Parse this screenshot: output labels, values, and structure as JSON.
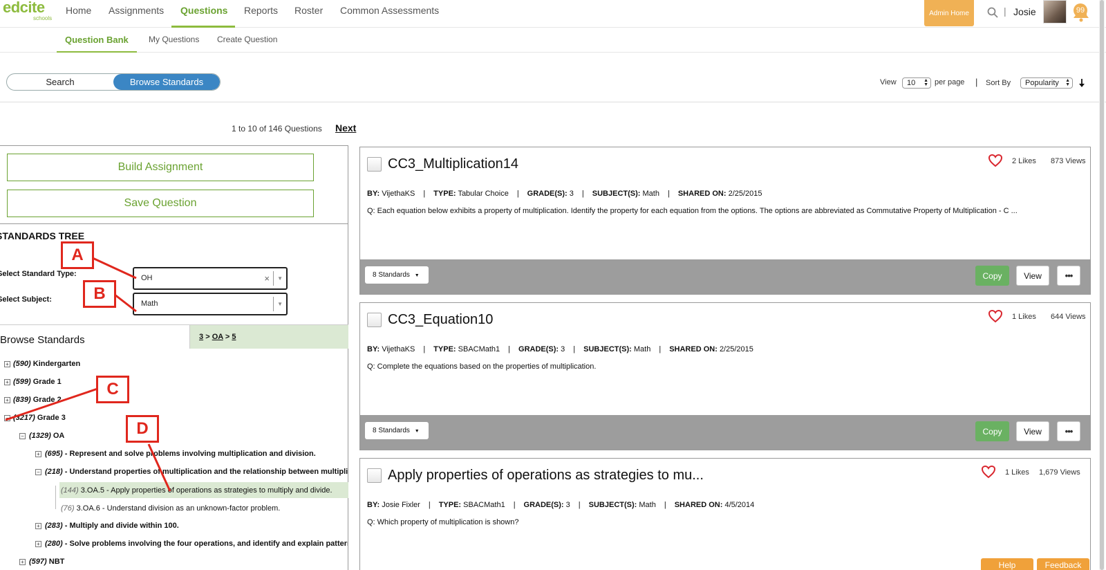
{
  "logo": {
    "text": "edcite",
    "sub": "schools"
  },
  "topnav": {
    "items": [
      "Home",
      "Assignments",
      "Questions",
      "Reports",
      "Roster",
      "Common Assessments"
    ],
    "admin_home": "Admin Home",
    "separator": "|",
    "user": "Josie",
    "notifications": "99"
  },
  "subnav": {
    "items": [
      "Question Bank",
      "My Questions",
      "Create Question"
    ]
  },
  "toggle": {
    "search": "Search",
    "browse": "Browse Standards"
  },
  "list_controls": {
    "view_label": "View",
    "per_page_value": "10",
    "per_page_label": "per page",
    "separator": "|",
    "sort_label": "Sort By",
    "sort_value": "Popularity"
  },
  "pager": {
    "text": "1 to 10 of 146 Questions",
    "next": "Next"
  },
  "left_panel": {
    "build_assignment": "Build Assignment",
    "save_question": "Save Question",
    "tree_title": "STANDARDS TREE",
    "standard_type_label": "Select Standard Type:",
    "standard_type_value": "OH",
    "subject_label": "Select Subject:",
    "subject_value": "Math",
    "browse_title": "Browse Standards",
    "crumb": [
      "3",
      "OA",
      "5"
    ],
    "crumb_sep": ">",
    "tree": [
      {
        "count": "(590)",
        "label": " Kindergarten",
        "sign": "+"
      },
      {
        "count": "(599)",
        "label": " Grade 1",
        "sign": "+"
      },
      {
        "count": "(839)",
        "label": " Grade 2",
        "sign": "+"
      },
      {
        "count": "(3217)",
        "label": " Grade 3",
        "sign": "−"
      },
      {
        "count": "(1329)",
        "label": " OA",
        "sign": "−"
      },
      {
        "count": "(695)",
        "label": " - Represent and solve problems involving multiplication and division.",
        "sign": "+"
      },
      {
        "count": "(218)",
        "label": " - Understand properties of multiplication and the relationship between multiplication and division.",
        "sign": "−"
      },
      {
        "count": "(144)",
        "label": " 3.OA.5 - Apply properties of operations as strategies to multiply and divide."
      },
      {
        "count": "(76)",
        "label": " 3.OA.6 - Understand division as an unknown-factor problem."
      },
      {
        "count": "(283)",
        "label": " - Multiply and divide within 100.",
        "sign": "+"
      },
      {
        "count": "(280)",
        "label": " - Solve problems involving the four operations, and identify and explain patterns in arithmetic.",
        "sign": "+"
      },
      {
        "count": "(597)",
        "label": " NBT",
        "sign": "+"
      }
    ]
  },
  "annotations": [
    "A",
    "B",
    "C",
    "D"
  ],
  "questions": [
    {
      "title": "CC3_Multiplication14",
      "likes": "2 Likes",
      "views": "873 Views",
      "by": "VijethaKS",
      "type": "Tabular Choice",
      "grades": "3",
      "subject": "Math",
      "shared_on": "2/25/2015",
      "question": "Q: Each equation below exhibits a property of multiplication. Identify the property for each equation from the options. The options are abbreviated as  Commutative Property of Multiplication - C ...",
      "standards": "8 Standards"
    },
    {
      "title": "CC3_Equation10",
      "likes": "1 Likes",
      "views": "644 Views",
      "by": "VijethaKS",
      "type": "SBACMath1",
      "grades": "3",
      "subject": "Math",
      "shared_on": "2/25/2015",
      "question": "Q: Complete the equations based on the properties of multiplication.",
      "standards": "8 Standards"
    },
    {
      "title": "Apply properties of operations as strategies to mu...",
      "likes": "1 Likes",
      "views": "1,679 Views",
      "by": "Josie Fixler",
      "type": "SBACMath1",
      "grades": "3",
      "subject": "Math",
      "shared_on": "4/5/2014",
      "question": "Q: Which property of multiplication is shown?",
      "standards": ""
    }
  ],
  "meta_labels": {
    "by": "BY:",
    "type": "TYPE:",
    "grades": "GRADE(S):",
    "subject": "SUBJECT(S):",
    "shared_on": "SHARED ON:",
    "sep": "|"
  },
  "actions": {
    "copy": "Copy",
    "view": "View",
    "more": "•••"
  },
  "footer": {
    "help": "Help",
    "feedback": "Feedback"
  },
  "colors": {
    "brand_green": "#8dbb3e",
    "accent_blue": "#3b86c4",
    "admin_orange": "#f0b155",
    "annotation_red": "#e0271d",
    "copy_green": "#6ab162"
  }
}
